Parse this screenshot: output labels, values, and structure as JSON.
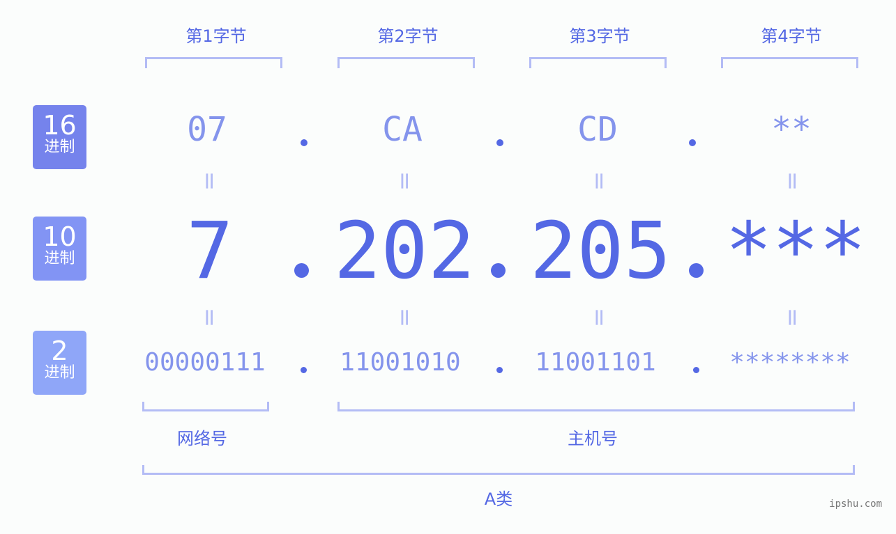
{
  "byte_labels": [
    "第1字节",
    "第2字节",
    "第3字节",
    "第4字节"
  ],
  "rows": {
    "hex": {
      "badge_num": "16",
      "badge_unit": "进制",
      "badge_color": "#7583ec",
      "values": [
        "07",
        "CA",
        "CD",
        "**"
      ]
    },
    "dec": {
      "badge_num": "10",
      "badge_unit": "进制",
      "badge_color": "#8294f4",
      "values": [
        "7",
        "202",
        "205",
        "***"
      ]
    },
    "bin": {
      "badge_num": "2",
      "badge_unit": "进制",
      "badge_color": "#8fa6f8",
      "values": [
        "00000111",
        "11001010",
        "11001101",
        "********"
      ]
    }
  },
  "separator": ".",
  "equals": "=",
  "sections": {
    "network": "网络号",
    "host": "主机号",
    "class": "A类"
  },
  "watermark": "ipshu.com",
  "colors": {
    "primary": "#5468e4",
    "secondary": "#8494ec",
    "bracket": "#b3bcf5"
  }
}
